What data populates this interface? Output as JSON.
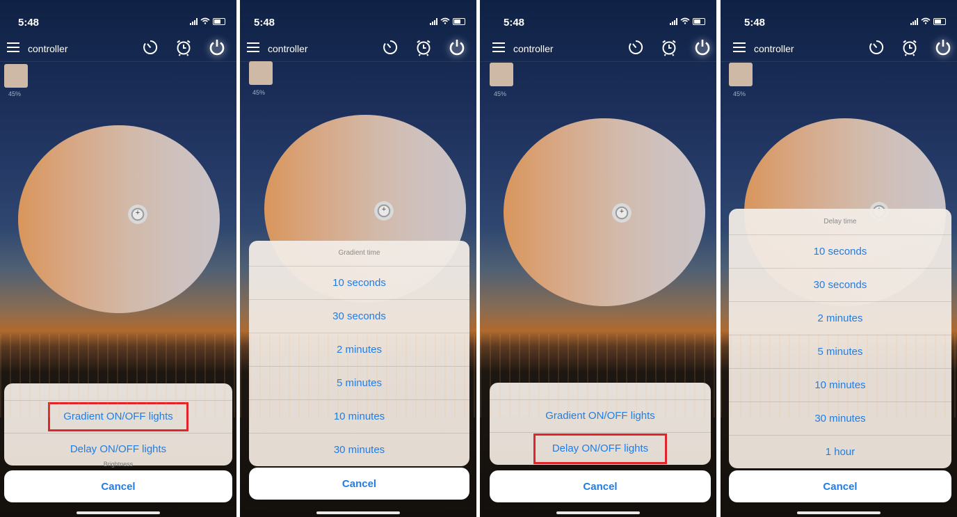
{
  "status": {
    "time": "5:48"
  },
  "app": {
    "title": "controller"
  },
  "color": {
    "swatch_hex": "#cdb9a5",
    "brightness_text": "45%"
  },
  "hidden_label": "Brightness",
  "screens": [
    {
      "sheet_title": "",
      "items": [
        "Gradient ON/OFF lights",
        "Delay ON/OFF lights"
      ],
      "highlighted_index": 0
    },
    {
      "sheet_title": "Gradient time",
      "items": [
        "10 seconds",
        "30 seconds",
        "2 minutes",
        "5 minutes",
        "10 minutes",
        "30 minutes"
      ],
      "highlighted_index": -1
    },
    {
      "sheet_title": "",
      "items": [
        "Gradient ON/OFF lights",
        "Delay ON/OFF lights"
      ],
      "highlighted_index": 1
    },
    {
      "sheet_title": "Delay time",
      "items": [
        "10 seconds",
        "30 seconds",
        "2 minutes",
        "5 minutes",
        "10 minutes",
        "30 minutes",
        "1 hour"
      ],
      "highlighted_index": -1
    }
  ],
  "cancel_label": "Cancel",
  "colors": {
    "action_blue": "#1f7de6",
    "highlight_red": "#e0242b"
  }
}
